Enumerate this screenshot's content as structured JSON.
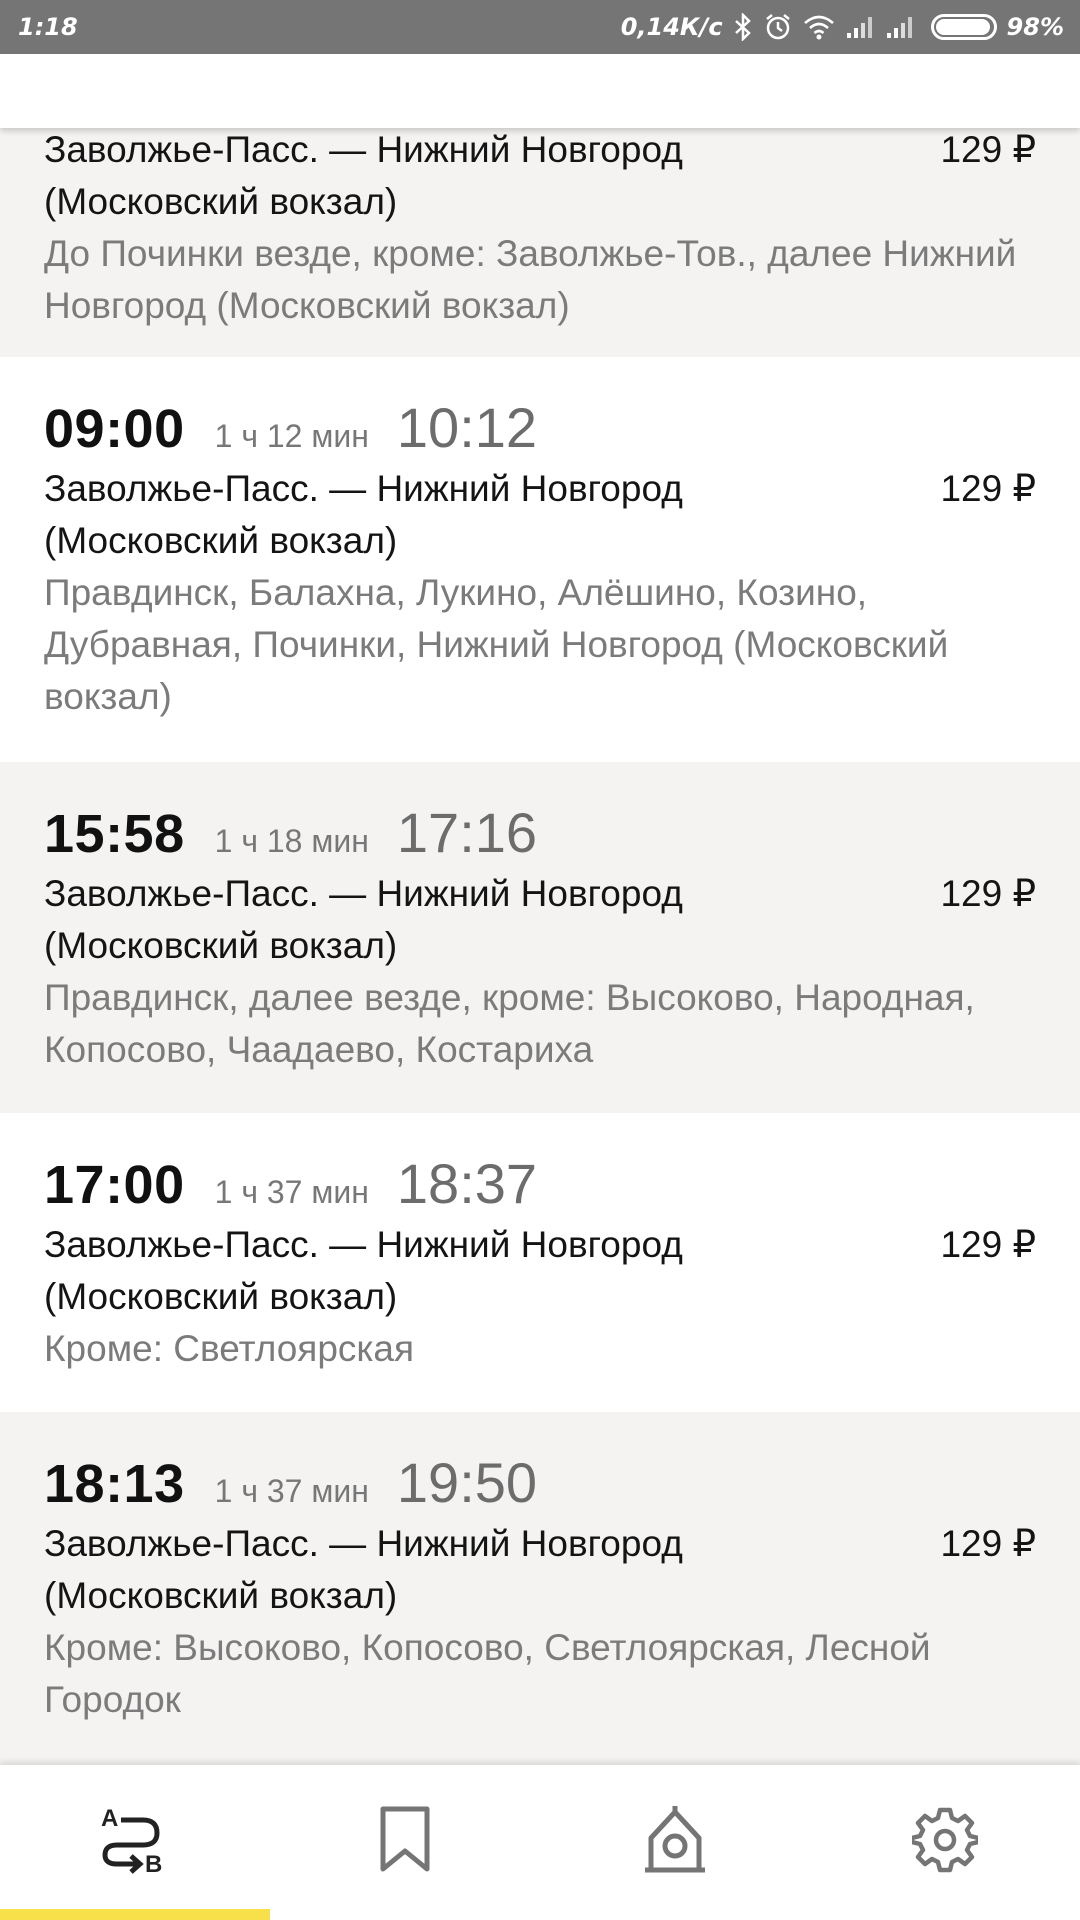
{
  "status_bar": {
    "time": "1:18",
    "speed": "0,14К/с",
    "battery_percent": "98%",
    "icons": [
      "bluetooth-icon",
      "alarm-icon",
      "wifi-icon",
      "signal-icon",
      "signal-icon",
      "battery-icon"
    ]
  },
  "trips": [
    {
      "departure": "",
      "duration": "",
      "arrival": "",
      "route_line1": "Заволжье-Пасс. — Нижний Новгород",
      "route_line2": "(Московский вокзал)",
      "price": "129 ₽",
      "stops": "До Починки везде, кроме: Заволжье-Тов., далее Нижний Новгород (Московский вокзал)"
    },
    {
      "departure": "09:00",
      "duration": "1 ч 12 мин",
      "arrival": "10:12",
      "route_line1": "Заволжье-Пасс. — Нижний Новгород",
      "route_line2": "(Московский вокзал)",
      "price": "129 ₽",
      "stops": "Правдинск, Балахна, Лукино, Алёшино, Козино, Дубравная, Починки, Нижний Новгород (Московский вокзал)"
    },
    {
      "departure": "15:58",
      "duration": "1 ч 18 мин",
      "arrival": "17:16",
      "route_line1": "Заволжье-Пасс. — Нижний Новгород",
      "route_line2": "(Московский вокзал)",
      "price": "129 ₽",
      "stops": "Правдинск, далее везде, кроме: Высоково, Народная, Копосово, Чаадаево, Костариха"
    },
    {
      "departure": "17:00",
      "duration": "1 ч 37 мин",
      "arrival": "18:37",
      "route_line1": "Заволжье-Пасс. — Нижний Новгород",
      "route_line2": "(Московский вокзал)",
      "price": "129 ₽",
      "stops": "Кроме: Светлоярская"
    },
    {
      "departure": "18:13",
      "duration": "1 ч 37 мин",
      "arrival": "19:50",
      "route_line1": "Заволжье-Пасс. — Нижний Новгород",
      "route_line2": "(Московский вокзал)",
      "price": "129 ₽",
      "stops": "Кроме: Высоково, Копосово, Светлоярская, Лесной Городок"
    }
  ],
  "bottom_nav": {
    "items": [
      {
        "icon": "route-a-to-b-icon",
        "active": true
      },
      {
        "icon": "bookmark-icon",
        "active": false
      },
      {
        "icon": "station-icon",
        "active": false
      },
      {
        "icon": "gear-icon",
        "active": false
      }
    ],
    "accent_color": "#f7e04a"
  },
  "colors": {
    "status_bar": "#757575",
    "row_grey": "#f4f3f2",
    "row_white": "#ffffff",
    "secondary_text": "#7b7b7b"
  }
}
